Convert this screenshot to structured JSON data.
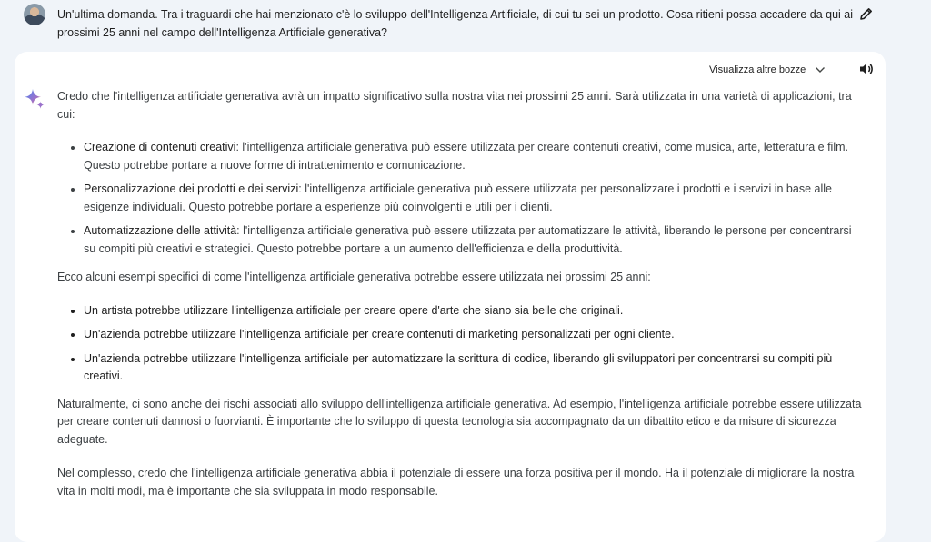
{
  "prompt": {
    "text": "Un'ultima domanda. Tra i traguardi che hai menzionato c'è lo sviluppo dell'Intelligenza Artificiale, di cui tu sei un prodotto. Cosa ritieni possa accadere da qui ai prossimi 25 anni nel campo dell'Intelligenza Artificiale generativa?"
  },
  "response": {
    "drafts_label": "Visualizza altre bozze",
    "intro": "Credo che l'intelligenza artificiale generativa avrà un impatto significativo sulla nostra vita nei prossimi 25 anni. Sarà utilizzata in una varietà di applicazioni, tra cui:",
    "applications": [
      {
        "title": "Creazione di contenuti creativi",
        "text": ": l'intelligenza artificiale generativa può essere utilizzata per creare contenuti creativi, come musica, arte, letteratura e film. Questo potrebbe portare a nuove forme di intrattenimento e comunicazione."
      },
      {
        "title": "Personalizzazione dei prodotti e dei servizi",
        "text": ": l'intelligenza artificiale generativa può essere utilizzata per personalizzare i prodotti e i servizi in base alle esigenze individuali. Questo potrebbe portare a esperienze più coinvolgenti e utili per i clienti."
      },
      {
        "title": "Automatizzazione delle attività",
        "text": ": l'intelligenza artificiale generativa può essere utilizzata per automatizzare le attività, liberando le persone per concentrarsi su compiti più creativi e strategici. Questo potrebbe portare a un aumento dell'efficienza e della produttività."
      }
    ],
    "examples_intro": "Ecco alcuni esempi specifici di come l'intelligenza artificiale generativa potrebbe essere utilizzata nei prossimi 25 anni:",
    "examples": [
      "Un artista potrebbe utilizzare l'intelligenza artificiale per creare opere d'arte che siano sia belle che originali.",
      "Un'azienda potrebbe utilizzare l'intelligenza artificiale per creare contenuti di marketing personalizzati per ogni cliente.",
      "Un'azienda potrebbe utilizzare l'intelligenza artificiale per automatizzare la scrittura di codice, liberando gli sviluppatori per concentrarsi su compiti più creativi."
    ],
    "risks": "Naturalmente, ci sono anche dei rischi associati allo sviluppo dell'intelligenza artificiale generativa. Ad esempio, l'intelligenza artificiale potrebbe essere utilizzata per creare contenuti dannosi o fuorvianti. È importante che lo sviluppo di questa tecnologia sia accompagnato da un dibattito etico e da misure di sicurezza adeguate.",
    "conclusion": "Nel complesso, credo che l'intelligenza artificiale generativa abbia il potenziale di essere una forza positiva per il mondo. Ha il potenziale di migliorare la nostra vita in molti modi, ma è importante che sia sviluppata in modo responsabile."
  },
  "icons": {
    "avatar": "user-avatar",
    "edit": "pencil-icon",
    "drafts": "chevron-down-icon",
    "speaker": "speaker-icon",
    "assistant": "sparkle-icon"
  },
  "colors": {
    "page_background": "#f0f4f9",
    "card_background": "#ffffff",
    "sparkle_blue": "#4285f4",
    "sparkle_purple": "#9b72cb",
    "sparkle_red": "#d96570"
  }
}
